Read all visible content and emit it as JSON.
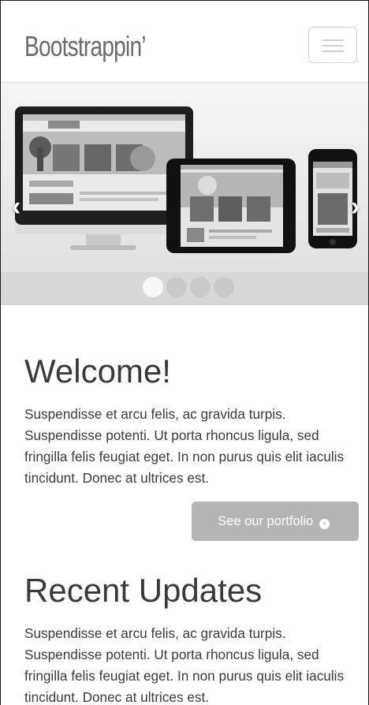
{
  "navbar": {
    "brand": "Bootstrappin’",
    "toggle_icon": "hamburger-menu-icon"
  },
  "carousel": {
    "prev_glyph": "‹",
    "next_glyph": "›",
    "slide_count": 4,
    "active_index": 0
  },
  "welcome": {
    "heading": "Welcome!",
    "text": "Suspendisse et arcu felis, ac gravida turpis. Suspendisse potenti. Ut porta rhoncus ligula, sed fringilla felis feugiat eget. In non purus quis elit iaculis tincidunt. Donec at ultrices est.",
    "button_label": "See our portfolio",
    "button_icon": "arrow-circle-right-icon",
    "button_icon_glyph": "›"
  },
  "recent": {
    "heading": "Recent Updates",
    "text": "Suspendisse et arcu felis, ac gravida turpis. Suspendisse potenti. Ut porta rhoncus ligula, sed fringilla felis feugiat eget. In non purus quis elit iaculis tincidunt. Donec at ultrices est."
  }
}
